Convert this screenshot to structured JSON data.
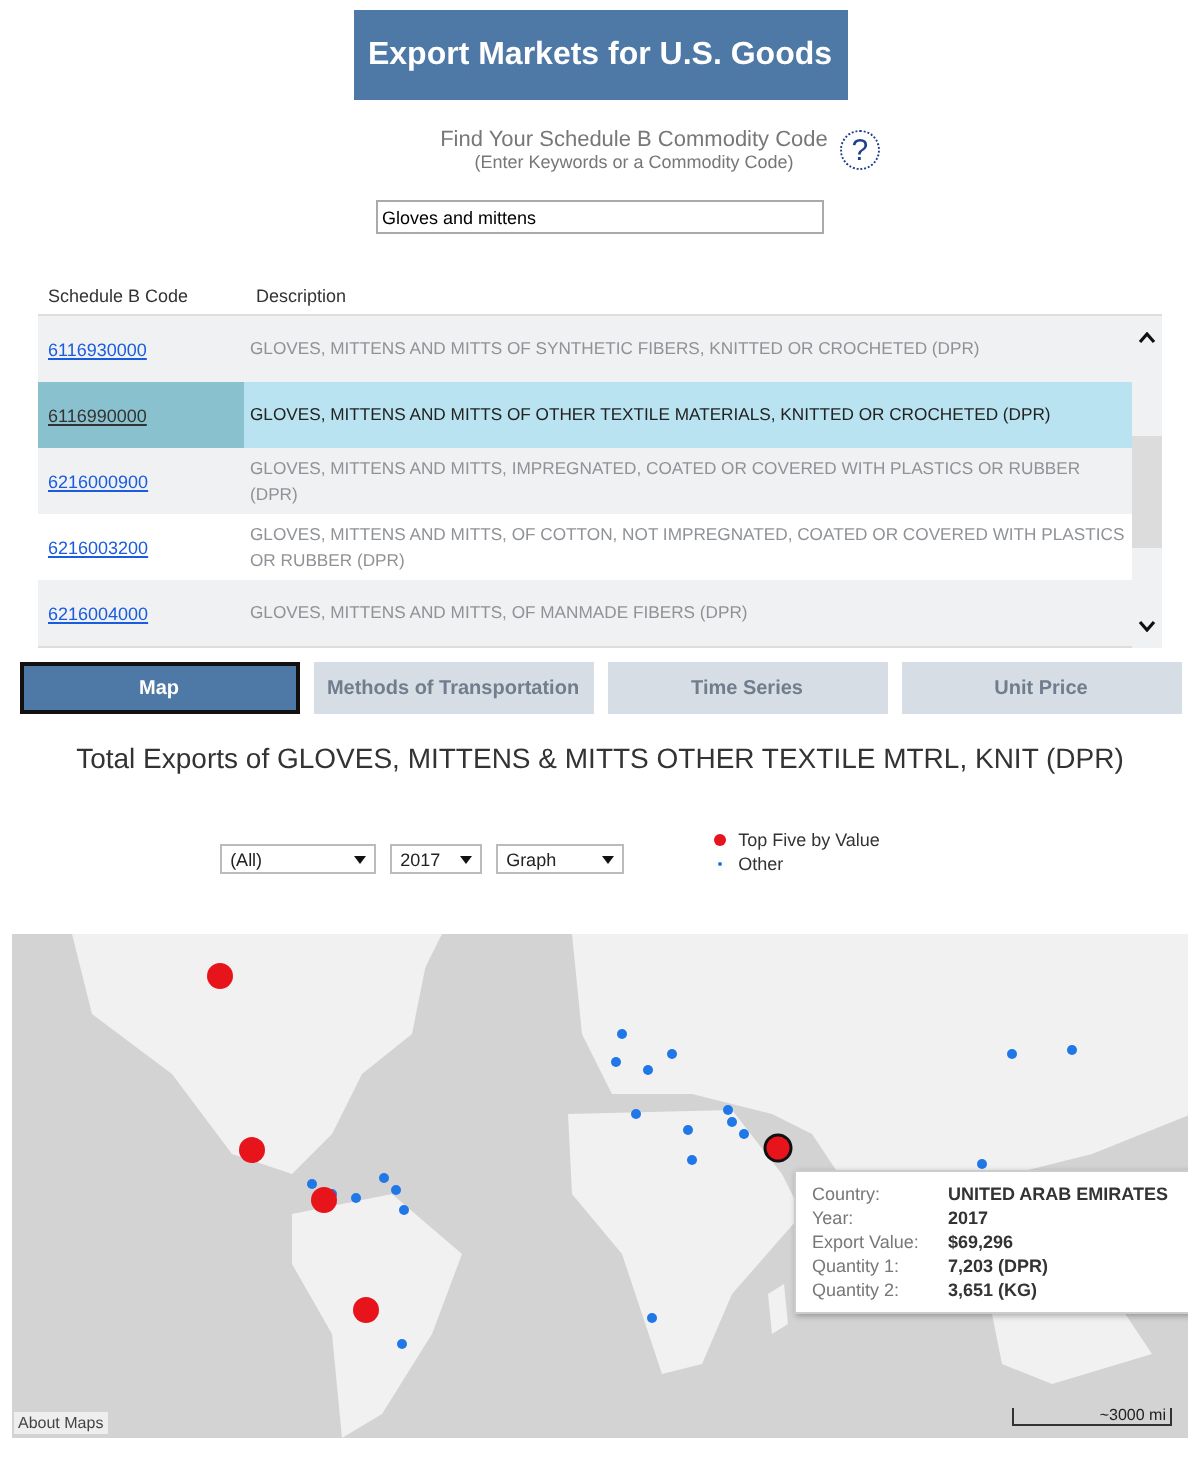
{
  "header": {
    "title": "Export Markets for U.S. Goods"
  },
  "finder": {
    "label": "Find Your Schedule B Commodity Code",
    "hint": "(Enter Keywords or a Commodity Code)",
    "help": "?",
    "search_value": "Gloves and mittens"
  },
  "table": {
    "columns": [
      "Schedule B Code",
      "Description"
    ],
    "rows": [
      {
        "code": "6116930000",
        "description": "GLOVES, MITTENS AND MITTS OF SYNTHETIC FIBERS, KNITTED OR CROCHETED (DPR)",
        "selected": false
      },
      {
        "code": "6116990000",
        "description": "GLOVES, MITTENS AND MITTS OF OTHER TEXTILE MATERIALS, KNITTED OR CROCHETED (DPR)",
        "selected": true
      },
      {
        "code": "6216000900",
        "description": "GLOVES, MITTENS AND MITTS, IMPREGNATED, COATED OR COVERED WITH PLASTICS OR RUBBER (DPR)",
        "selected": false
      },
      {
        "code": "6216003200",
        "description": "GLOVES, MITTENS AND MITTS, OF COTTON, NOT IMPREGNATED, COATED OR COVERED WITH PLASTICS OR RUBBER (DPR)",
        "selected": false
      },
      {
        "code": "6216004000",
        "description": "GLOVES, MITTENS AND MITTS, OF MANMADE FIBERS (DPR)",
        "selected": false
      }
    ]
  },
  "tabs": [
    {
      "label": "Map",
      "selected": true
    },
    {
      "label": "Methods of Transportation",
      "selected": false
    },
    {
      "label": "Time Series",
      "selected": false
    },
    {
      "label": "Unit Price",
      "selected": false
    }
  ],
  "chart_title": "Total Exports of GLOVES, MITTENS & MITTS OTHER TEXTILE MTRL, KNIT (DPR)",
  "filters": [
    {
      "value": "(All)"
    },
    {
      "value": "2017"
    },
    {
      "value": "Graph"
    }
  ],
  "legend": [
    {
      "label": "Top Five by Value",
      "color": "#e8141c",
      "kind": "big"
    },
    {
      "label": "Other",
      "color": "#1f77e8",
      "kind": "small"
    }
  ],
  "map": {
    "about": "About Maps",
    "scale": "~3000 mi",
    "tooltip": [
      {
        "label": "Country:",
        "value": "UNITED ARAB EMIRATES"
      },
      {
        "label": "Year:",
        "value": "2017"
      },
      {
        "label": "Export Value:",
        "value": "$69,296"
      },
      {
        "label": "Quantity 1:",
        "value": "7,203 (DPR)"
      },
      {
        "label": "Quantity 2:",
        "value": "3,651 (KG)"
      }
    ]
  }
}
